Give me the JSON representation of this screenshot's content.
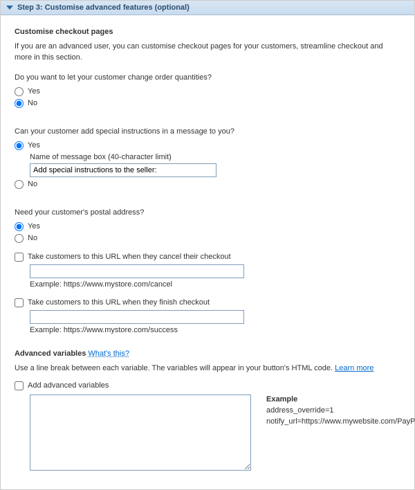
{
  "header": {
    "title": "Step 3: Customise advanced features (optional)"
  },
  "checkout": {
    "title": "Customise checkout pages",
    "intro": "If you are an advanced user, you can customise checkout pages for your customers, streamline checkout and more in this section.",
    "q_qty": "Do you want to let your customer change order quantities?",
    "q_msg": "Can your customer add special instructions in a message to you?",
    "q_addr": "Need your customer's postal address?",
    "yes": "Yes",
    "no": "No",
    "msg_box_label": "Name of message box (40-character limit)",
    "msg_box_value": "Add special instructions to the seller:"
  },
  "urls": {
    "cancel_label": "Take customers to this URL when they cancel their checkout",
    "cancel_value": "",
    "cancel_example": "Example: https://www.mystore.com/cancel",
    "finish_label": "Take customers to this URL when they finish checkout",
    "finish_value": "",
    "finish_example": "Example: https://www.mystore.com/success"
  },
  "advanced": {
    "heading": "Advanced variables",
    "whats_this": "What's this?",
    "help_text": "Use a line break between each variable. The variables will appear in your button's HTML code.",
    "learn_more": "Learn more",
    "checkbox_label": "Add advanced variables",
    "textarea_value": "",
    "example_title": "Example",
    "example_line1": "address_override=1",
    "example_line2": "notify_url=https://www.mywebsite.com/PayPal_IPN"
  }
}
